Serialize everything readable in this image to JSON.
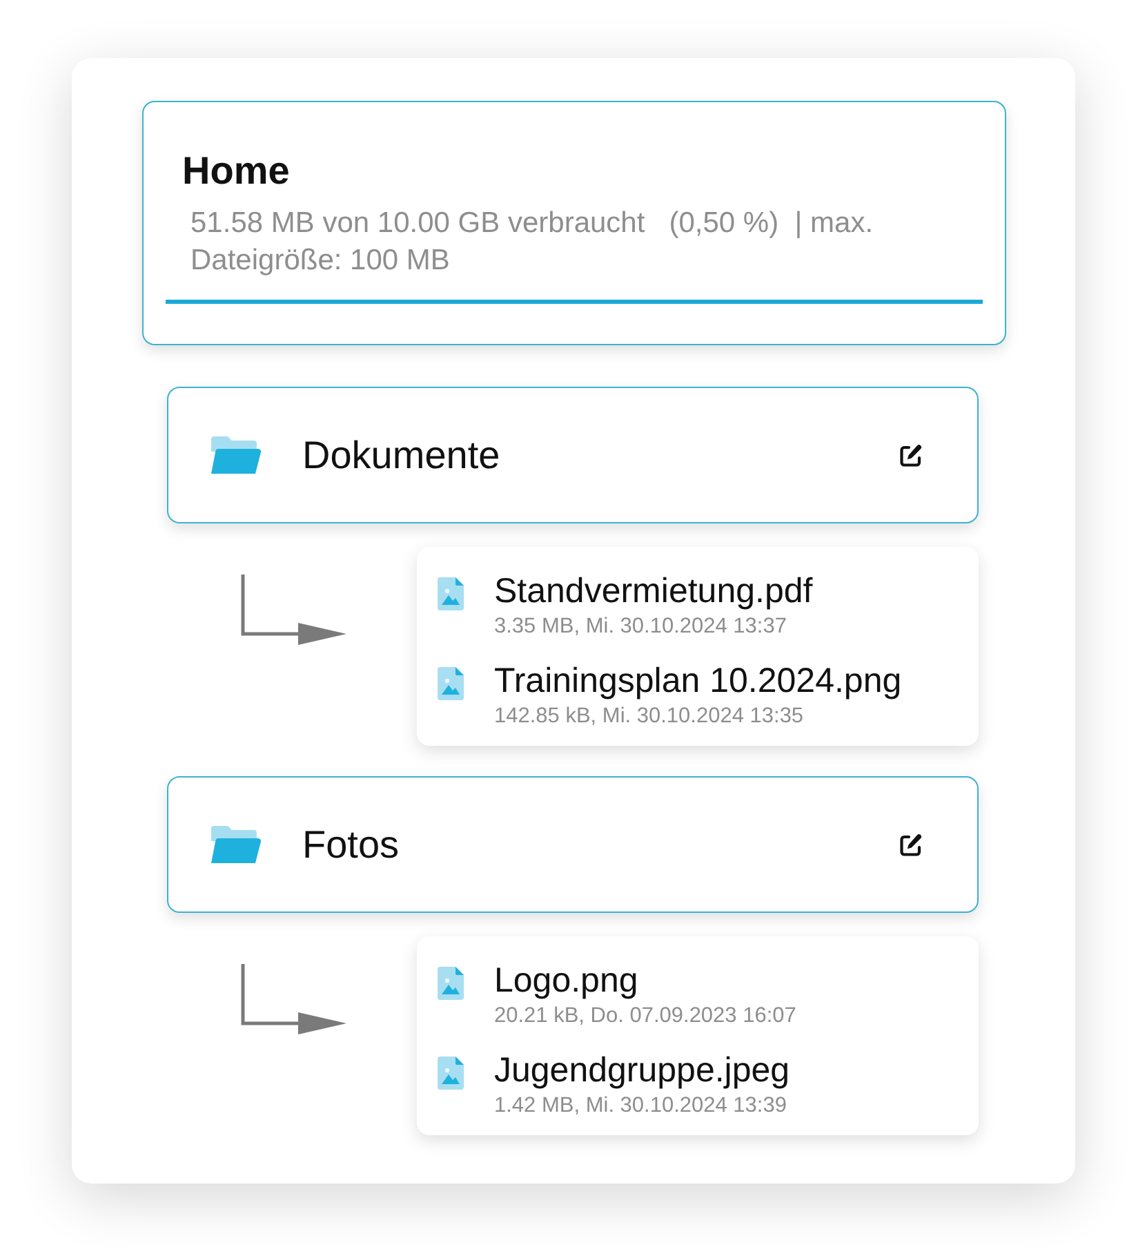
{
  "storage": {
    "title": "Home",
    "usage": "51.58 MB von 10.00 GB verbraucht   (0,50 %)  | max. Dateigröße: 100 MB"
  },
  "folders": [
    {
      "name": "Dokumente",
      "files": [
        {
          "name": "Standvermietung.pdf",
          "meta": "3.35 MB, Mi. 30.10.2024 13:37"
        },
        {
          "name": "Trainingsplan 10.2024.png",
          "meta": "142.85 kB, Mi. 30.10.2024 13:35"
        }
      ]
    },
    {
      "name": "Fotos",
      "files": [
        {
          "name": "Logo.png",
          "meta": "20.21 kB, Do. 07.09.2023 16:07"
        },
        {
          "name": "Jugendgruppe.jpeg",
          "meta": "1.42 MB, Mi. 30.10.2024 13:39"
        }
      ]
    }
  ]
}
